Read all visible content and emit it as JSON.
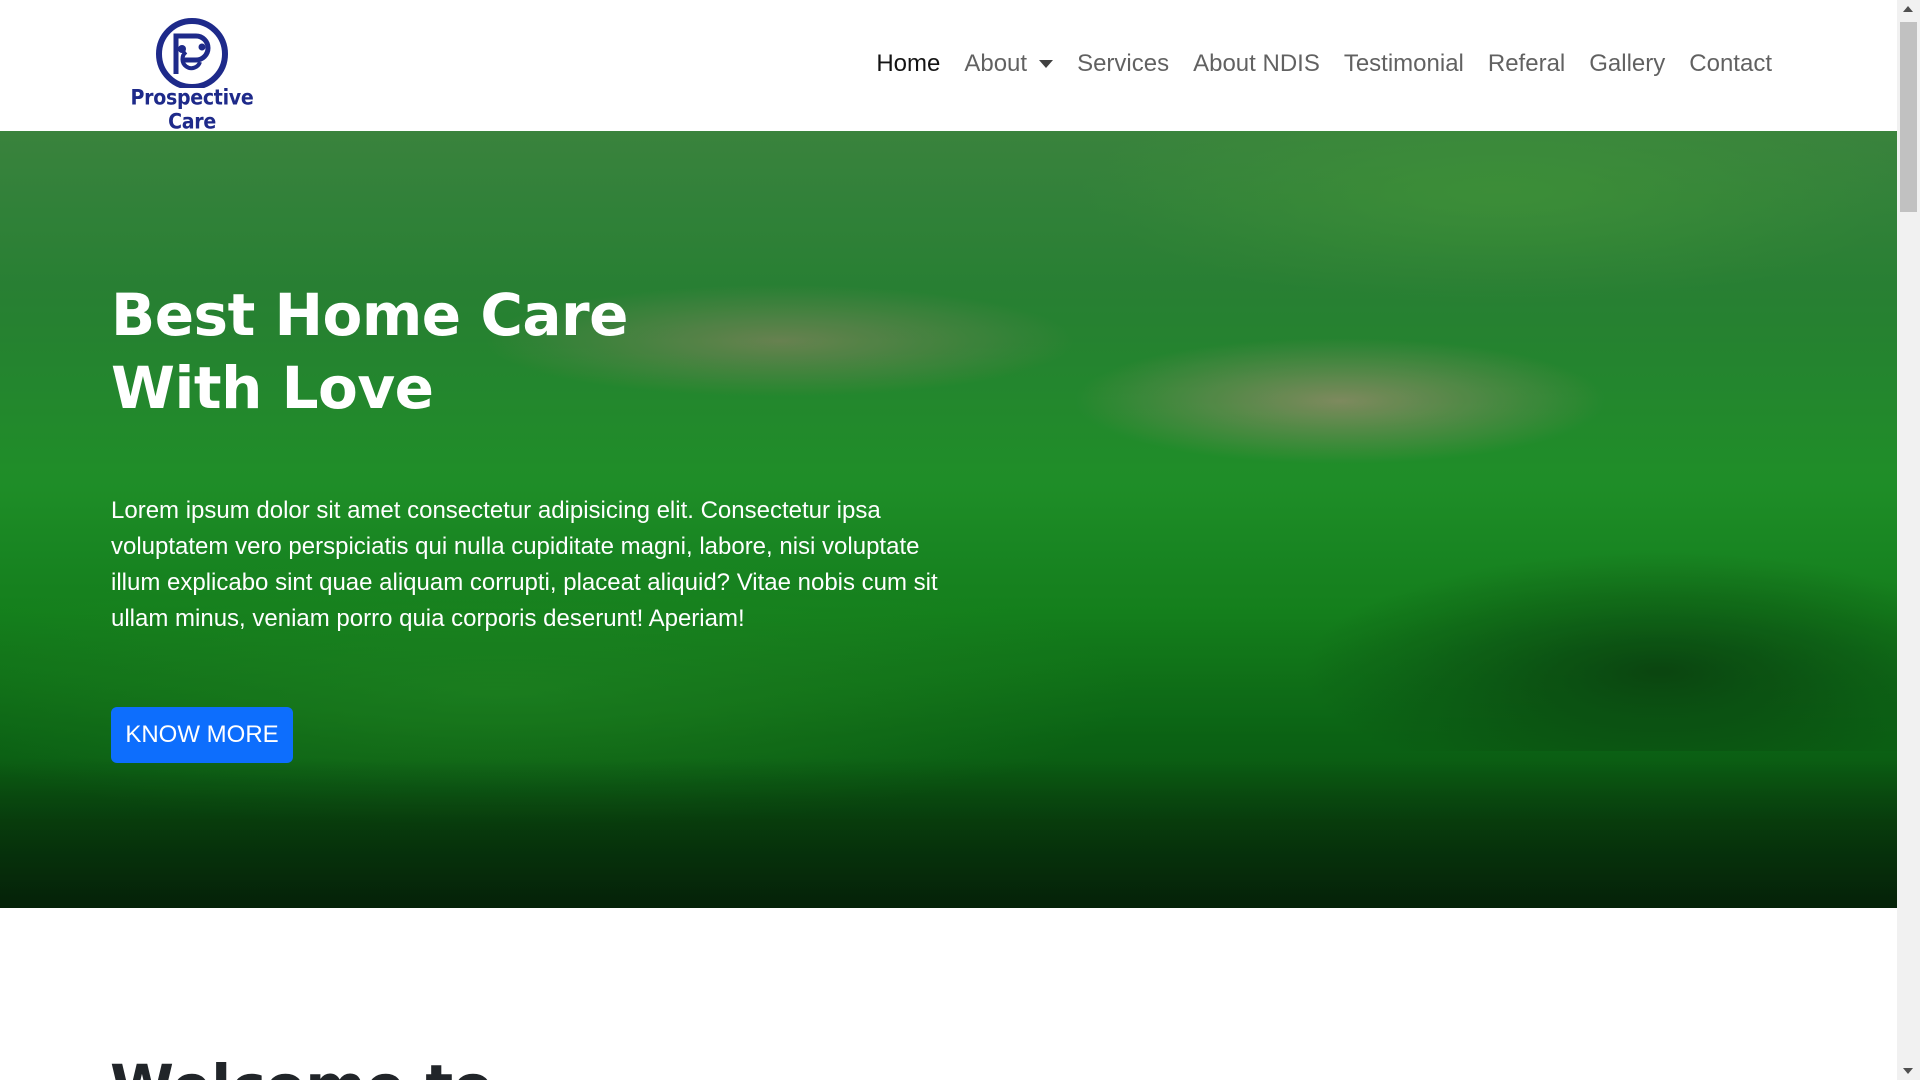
{
  "brand": {
    "name": "Prospective Care",
    "color": "#1e2a8a"
  },
  "nav": {
    "items": [
      {
        "label": "Home",
        "active": true
      },
      {
        "label": "About",
        "dropdown": true
      },
      {
        "label": "Services"
      },
      {
        "label": "About NDIS"
      },
      {
        "label": "Testimonial"
      },
      {
        "label": "Referal"
      },
      {
        "label": "Gallery"
      },
      {
        "label": "Contact"
      }
    ]
  },
  "hero": {
    "title_line1": "Best Home Care",
    "title_line2": "With Love",
    "text": "Lorem ipsum dolor sit amet consectetur adipisicing elit. Consectetur ipsa voluptatem vero perspiciatis qui nulla cupiditate magni, labore, nisi voluptate illum explicabo sint quae aliquam corrupti, placeat aliquid? Vitae nobis cum sit ullam minus, veniam porro quia corporis deserunt! Aperiam!",
    "button_label": "KNOW MORE",
    "button_color": "#0d6efd",
    "background_image": "green rolling hills landscape"
  },
  "welcome": {
    "heading": "Welcome to"
  }
}
